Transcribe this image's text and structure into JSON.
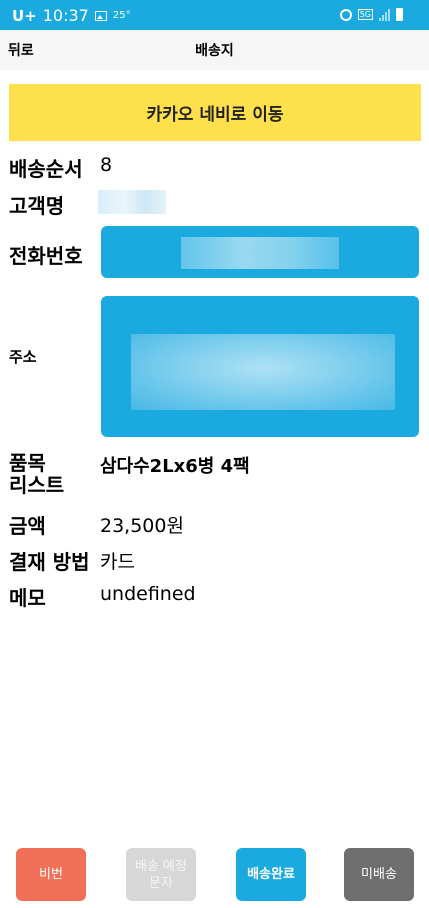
{
  "status_bar": {
    "carrier": "U+",
    "time": "10:37",
    "temperature": "25°",
    "network": "5G"
  },
  "header": {
    "back_label": "뒤로",
    "title": "배송지"
  },
  "kakao_nav_label": "카카오 네비로 이동",
  "fields": {
    "order_label": "배송순서",
    "order_value": "8",
    "customer_label": "고객명",
    "phone_label": "전화번호",
    "address_label": "주소",
    "items_label_line1": "품목",
    "items_label_line2": "리스트",
    "items_value": "삼다수2Lx6병 4팩",
    "amount_label": "금액",
    "amount_value": "23,500원",
    "payment_label": "결재 방법",
    "payment_value": "카드",
    "memo_label": "메모",
    "memo_value": "undefined"
  },
  "bottom_buttons": {
    "bibeon": "비번",
    "notice_line1": "배송 예정",
    "notice_line2": "문자",
    "done": "배송완료",
    "undelivered": "미배송"
  },
  "colors": {
    "accent_blue": "#1aaae0",
    "kakao_yellow": "#fde04b",
    "bibeon_red": "#f07158",
    "disabled_gray": "#d7d7d7",
    "dark_gray": "#6e6e6e"
  }
}
